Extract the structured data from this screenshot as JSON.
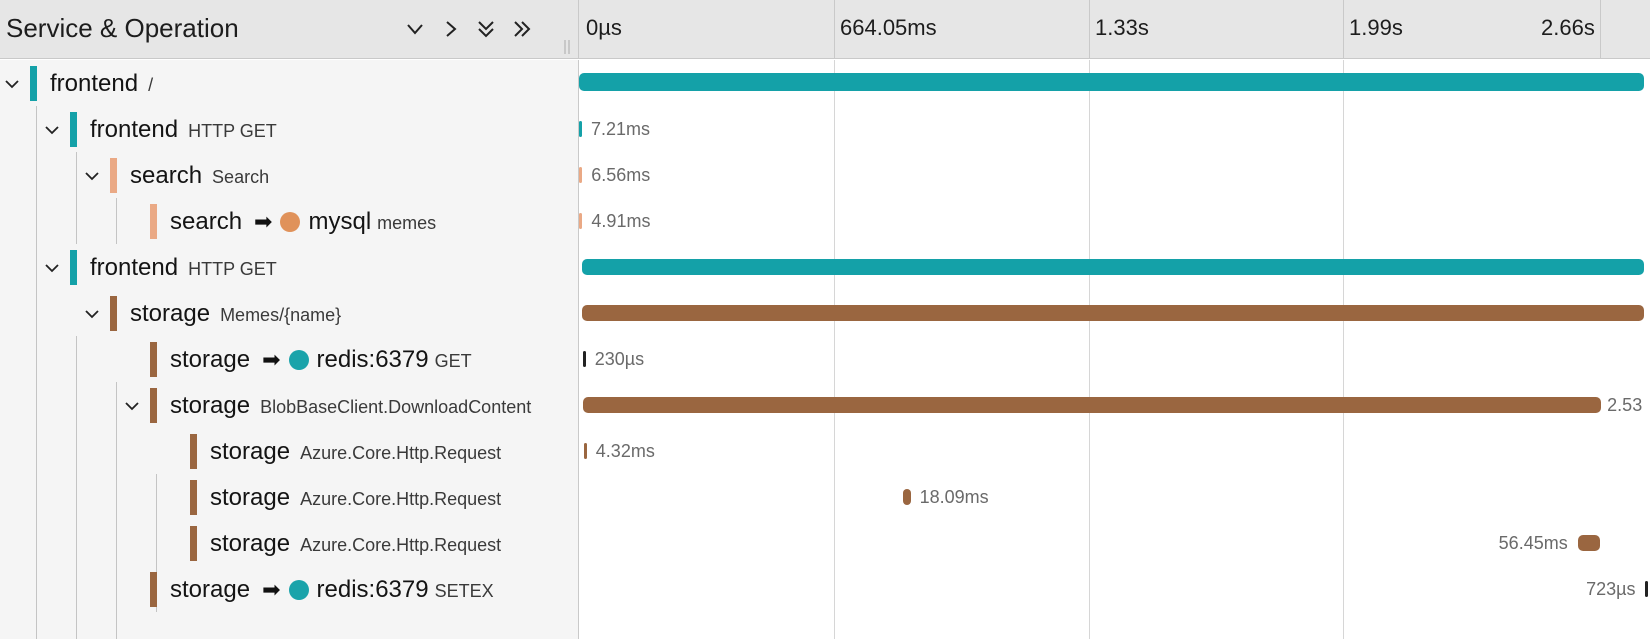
{
  "header": {
    "title": "Service & Operation",
    "controls": [
      {
        "name": "collapse-one-icon",
        "glyph": "chevron-down"
      },
      {
        "name": "expand-one-icon",
        "glyph": "chevron-right"
      },
      {
        "name": "collapse-all-icon",
        "glyph": "double-chevron-down"
      },
      {
        "name": "expand-all-icon",
        "glyph": "double-chevron-right"
      }
    ],
    "ticks": [
      "0µs",
      "664.05ms",
      "1.33s",
      "1.99s",
      "2.66s"
    ]
  },
  "rows": [
    {
      "service": "frontend",
      "operation": "/",
      "color": "#14a1a8",
      "depth": 0,
      "expandable": true,
      "peer": null,
      "peer_op": null,
      "peer_color": null,
      "duration": "",
      "start_frac": 0.0,
      "dur_frac": 1.0
    },
    {
      "service": "frontend",
      "operation": "HTTP GET",
      "color": "#14a1a8",
      "depth": 1,
      "expandable": true,
      "peer": null,
      "peer_op": null,
      "peer_color": null,
      "duration": "7.21ms",
      "start_frac": 0.0,
      "dur_frac": 0.0027
    },
    {
      "service": "search",
      "operation": "Search",
      "color": "#eaa985",
      "depth": 2,
      "expandable": true,
      "peer": null,
      "peer_op": null,
      "peer_color": null,
      "duration": "6.56ms",
      "start_frac": 0.0002,
      "dur_frac": 0.0025
    },
    {
      "service": "search",
      "operation": "",
      "color": "#eaa985",
      "depth": 3,
      "expandable": false,
      "peer": "mysql",
      "peer_op": "memes",
      "peer_color": "#e0925a",
      "duration": "4.91ms",
      "start_frac": 0.0004,
      "dur_frac": 0.0018
    },
    {
      "service": "frontend",
      "operation": "HTTP GET",
      "color": "#14a1a8",
      "depth": 1,
      "expandable": true,
      "peer": null,
      "peer_op": null,
      "peer_color": null,
      "duration": "",
      "start_frac": 0.003,
      "dur_frac": 0.997
    },
    {
      "service": "storage",
      "operation": "Memes/{name}",
      "color": "#9a6640",
      "depth": 2,
      "expandable": true,
      "peer": null,
      "peer_op": null,
      "peer_color": null,
      "duration": "",
      "start_frac": 0.0032,
      "dur_frac": 0.9968
    },
    {
      "service": "storage",
      "operation": "",
      "color": "#9a6640",
      "depth": 3,
      "expandable": false,
      "peer": "redis:6379",
      "peer_op": "GET",
      "peer_color": "#1aa3aa",
      "duration": "230µs",
      "start_frac": 0.0035,
      "dur_frac": 0.0001
    },
    {
      "service": "storage",
      "operation": "BlobBaseClient.DownloadContent",
      "color": "#9a6640",
      "depth": 3,
      "expandable": true,
      "peer": null,
      "peer_op": null,
      "peer_color": null,
      "duration": "2.53",
      "start_frac": 0.004,
      "dur_frac": 0.954
    },
    {
      "service": "storage",
      "operation": "Azure.Core.Http.Request",
      "color": "#9a6640",
      "depth": 4,
      "expandable": false,
      "peer": null,
      "peer_op": null,
      "peer_color": null,
      "duration": "4.32ms",
      "start_frac": 0.0045,
      "dur_frac": 0.0016
    },
    {
      "service": "storage",
      "operation": "Azure.Core.Http.Request",
      "color": "#9a6640",
      "depth": 4,
      "expandable": false,
      "peer": null,
      "peer_op": null,
      "peer_color": null,
      "duration": "18.09ms",
      "start_frac": 0.304,
      "dur_frac": 0.0068
    },
    {
      "service": "storage",
      "operation": "Azure.Core.Http.Request",
      "color": "#9a6640",
      "depth": 4,
      "expandable": false,
      "peer": null,
      "peer_op": null,
      "peer_color": null,
      "duration": "56.45ms",
      "start_frac": 0.936,
      "dur_frac": 0.021
    },
    {
      "service": "storage",
      "operation": "",
      "color": "#9a6640",
      "depth": 3,
      "expandable": false,
      "peer": "redis:6379",
      "peer_op": "SETEX",
      "peer_color": "#1aa3aa",
      "duration": "723µs",
      "start_frac": 0.9995,
      "dur_frac": 0.0003
    }
  ]
}
